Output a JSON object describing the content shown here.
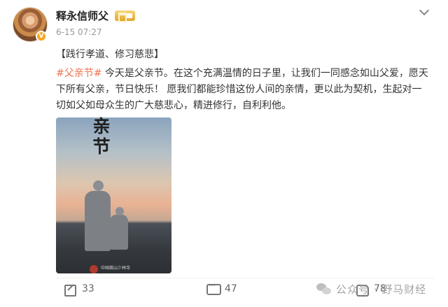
{
  "author": {
    "name": "释永信师父",
    "timestamp": "6-15 07:27"
  },
  "icons": {
    "avatar": "monk-portrait",
    "badge": "verified-v-icon",
    "vip": "vip-membership-icon",
    "menu": "chevron-down-icon",
    "share": "share-icon",
    "comment": "comment-icon",
    "like": "like-icon",
    "watermark": "wechat-icon"
  },
  "avatar_badge": "V",
  "post": {
    "heading": "【践行孝道、修习慈悲】",
    "hashtag": "#父亲节#",
    "body": " 今天是父亲节。在这个充满温情的日子里，让我们一同感念如山父爱，愿天下所有父亲，节日快乐！ 愿我们都能珍惜这份人间的亲情，更以此为契机，生起对一切如父如母众生的广大慈悲心，精进修行，自利利他。"
  },
  "poster": {
    "title": "亲节",
    "caption": "中国嵩山少林寺"
  },
  "actions": {
    "share_count": "33",
    "comment_count": "47",
    "like_count": "78"
  },
  "watermark": {
    "text": "公众号 · 野马财经"
  },
  "colors": {
    "hashtag": "#eb7350",
    "vip_gold": "#e0a72d",
    "badge_orange": "#f5a623"
  }
}
